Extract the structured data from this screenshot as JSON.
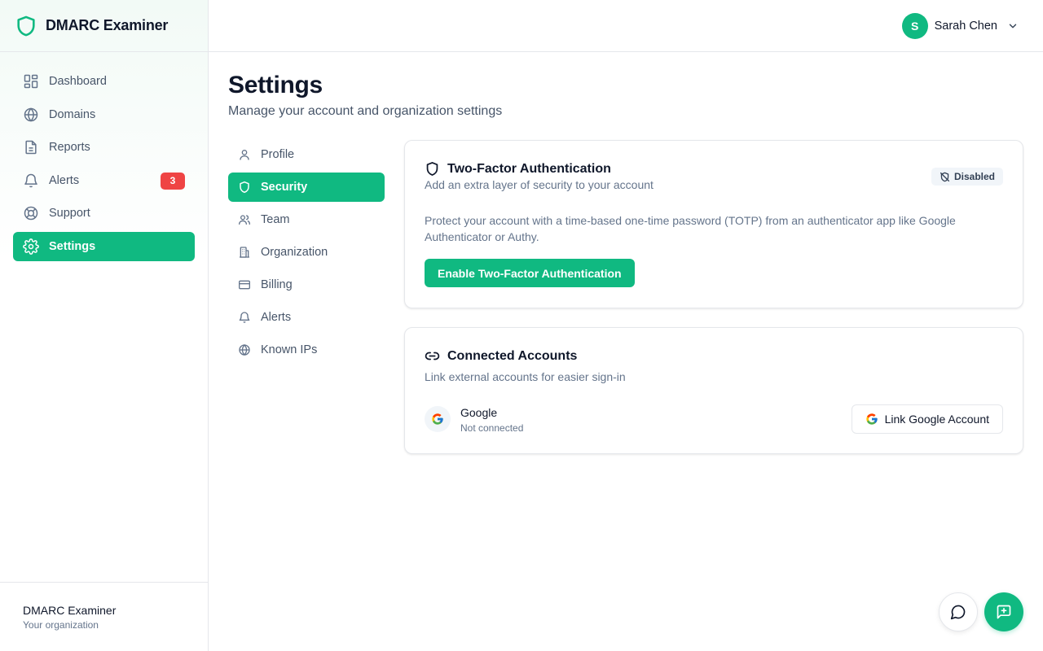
{
  "app": {
    "name": "DMARC Examiner"
  },
  "sidebar": {
    "items": [
      {
        "label": "Dashboard",
        "icon": "dashboard-icon"
      },
      {
        "label": "Domains",
        "icon": "globe-icon"
      },
      {
        "label": "Reports",
        "icon": "file-icon"
      },
      {
        "label": "Alerts",
        "icon": "bell-icon",
        "badge": "3"
      },
      {
        "label": "Support",
        "icon": "lifebuoy-icon"
      },
      {
        "label": "Settings",
        "icon": "gear-icon",
        "active": true
      }
    ],
    "footer": {
      "org_name": "DMARC Examiner",
      "org_sub": "Your organization"
    }
  },
  "topbar": {
    "user_initial": "S",
    "user_name": "Sarah Chen"
  },
  "page": {
    "title": "Settings",
    "subtitle": "Manage your account and organization settings"
  },
  "settings_nav": {
    "items": [
      {
        "label": "Profile",
        "icon": "user-icon"
      },
      {
        "label": "Security",
        "icon": "shield-icon",
        "active": true
      },
      {
        "label": "Team",
        "icon": "users-icon"
      },
      {
        "label": "Organization",
        "icon": "building-icon"
      },
      {
        "label": "Billing",
        "icon": "credit-card-icon"
      },
      {
        "label": "Alerts",
        "icon": "bell-icon"
      },
      {
        "label": "Known IPs",
        "icon": "globe-icon"
      }
    ]
  },
  "two_factor": {
    "title": "Two-Factor Authentication",
    "subtitle": "Add an extra layer of security to your account",
    "status": "Disabled",
    "description": "Protect your account with a time-based one-time password (TOTP) from an authenticator app like Google Authenticator or Authy.",
    "button_label": "Enable Two-Factor Authentication"
  },
  "connected_accounts": {
    "title": "Connected Accounts",
    "subtitle": "Link external accounts for easier sign-in",
    "provider_name": "Google",
    "provider_status": "Not connected",
    "button_label": "Link Google Account"
  },
  "colors": {
    "accent": "#10b981",
    "badge": "#ef4444",
    "text": "#0f172a",
    "muted": "#64748b"
  }
}
